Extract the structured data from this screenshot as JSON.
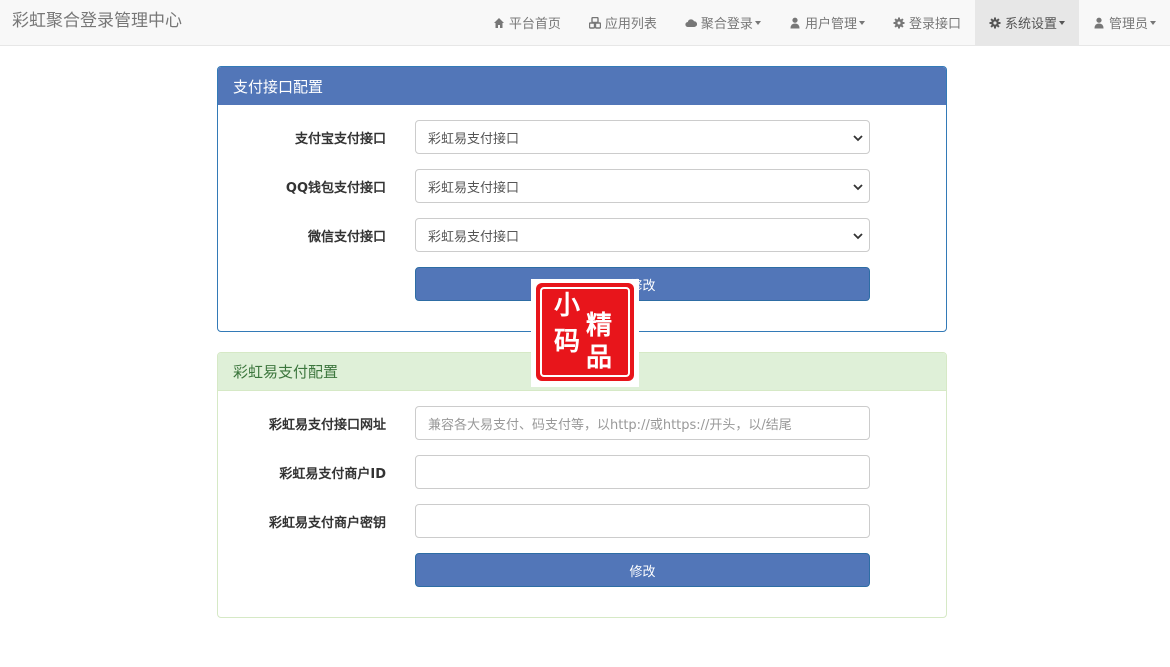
{
  "brand": "彩虹聚合登录管理中心",
  "nav": {
    "home": "平台首页",
    "apps": "应用列表",
    "login": "聚合登录",
    "users": "用户管理",
    "login_api": "登录接口",
    "settings": "系统设置",
    "admin": "管理员"
  },
  "payment_panel": {
    "title": "支付接口配置",
    "alipay_label": "支付宝支付接口",
    "alipay_value": "彩虹易支付接口",
    "qqpay_label": "QQ钱包支付接口",
    "qqpay_value": "彩虹易支付接口",
    "wxpay_label": "微信支付接口",
    "wxpay_value": "彩虹易支付接口",
    "submit": "修改"
  },
  "epay_panel": {
    "title": "彩虹易支付配置",
    "url_label": "彩虹易支付接口网址",
    "url_placeholder": "兼容各大易支付、码支付等，以http://或https://开头，以/结尾",
    "pid_label": "彩虹易支付商户ID",
    "pid_value": "",
    "key_label": "彩虹易支付商户密钥",
    "key_value": "",
    "submit": "修改"
  },
  "watermark": {
    "chars": [
      "小",
      "精",
      "码",
      "品"
    ]
  },
  "colors": {
    "primary": "#5276b8",
    "success_bg": "#dff0d8",
    "success_text": "#3c763d",
    "stamp_red": "#e8151b"
  }
}
